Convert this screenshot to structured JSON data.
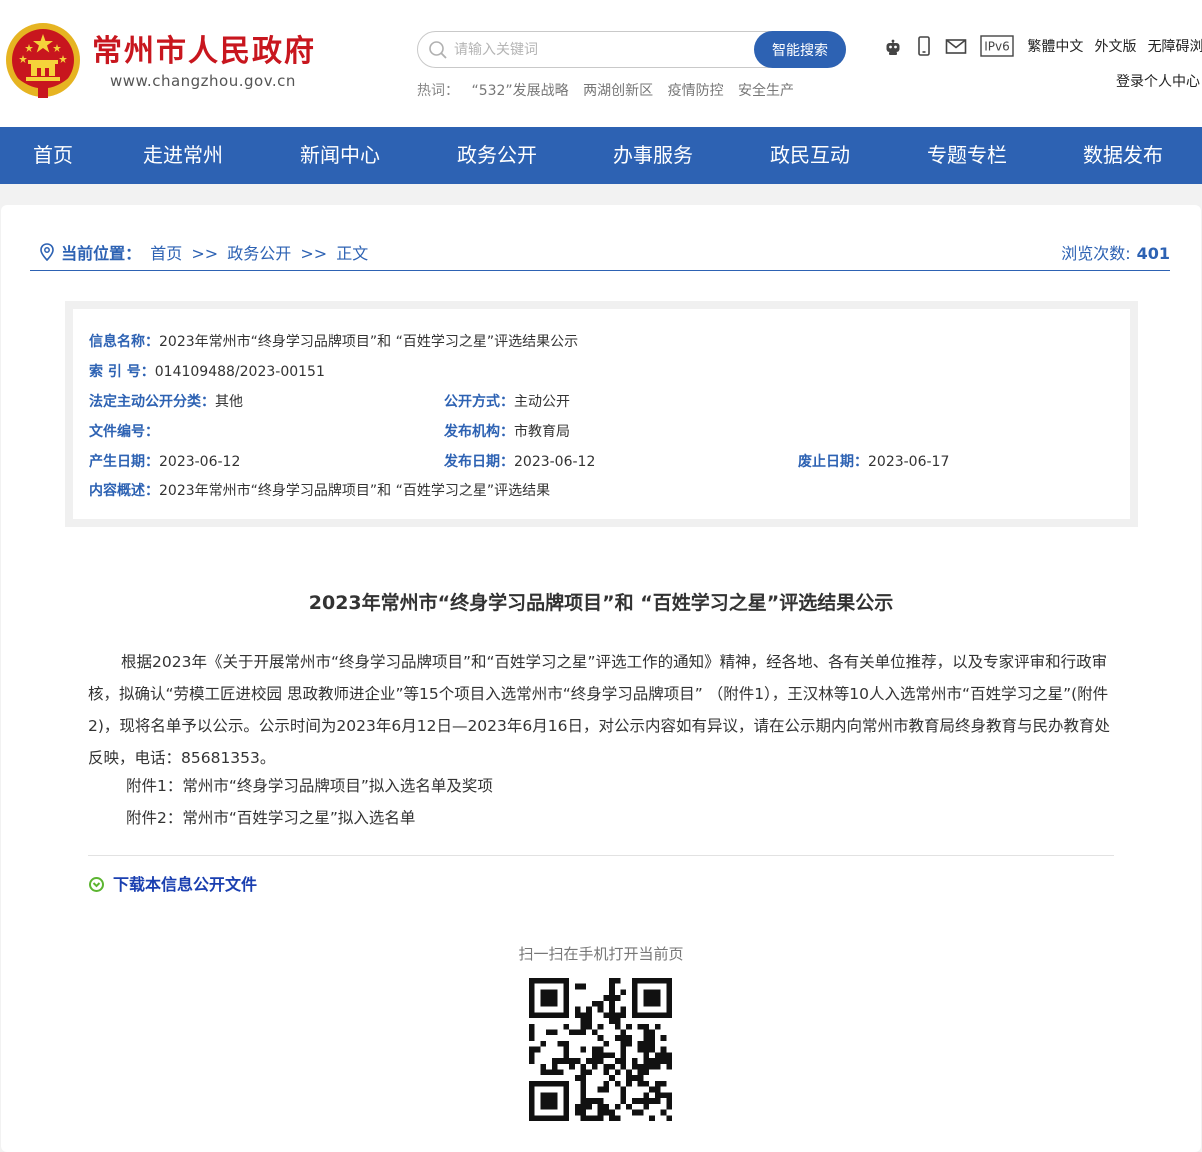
{
  "header": {
    "site_title": "常州市人民政府",
    "site_url": "www.changzhou.gov.cn",
    "search": {
      "placeholder": "请输入关键词",
      "button_label": "智能搜索"
    },
    "hot_label": "热词：",
    "hot_words": [
      "“532”发展战略",
      "两湖创新区",
      "疫情防控",
      "安全生产"
    ],
    "tool_icons": [
      "robot-icon",
      "mobile-icon",
      "mail-icon",
      "ipv6-icon"
    ],
    "ipv6_text": "IPv6",
    "links": [
      "繁體中文",
      "外文版",
      "无障碍浏览"
    ],
    "login_label": "登录个人中心"
  },
  "nav": {
    "items": [
      "首页",
      "走进常州",
      "新闻中心",
      "政务公开",
      "办事服务",
      "政民互动",
      "专题专栏",
      "数据发布"
    ]
  },
  "breadcrumb": {
    "label": "当前位置：",
    "items": [
      "首页",
      "政务公开",
      "正文"
    ],
    "separator": ">>",
    "views_label": "浏览次数:",
    "views_count": "401"
  },
  "info": {
    "name_label": "信息名称：",
    "name_value": "2023年常州市“终身学习品牌项目”和 “百姓学习之星”评选结果公示",
    "index_label": "索 引 号：",
    "index_value": "014109488/2023-00151",
    "category_label": "法定主动公开分类：",
    "category_value": "其他",
    "method_label": "公开方式：",
    "method_value": "主动公开",
    "docno_label": "文件编号：",
    "docno_value": "",
    "org_label": "发布机构：",
    "org_value": "市教育局",
    "created_label": "产生日期：",
    "created_value": "2023-06-12",
    "published_label": "发布日期：",
    "published_value": "2023-06-12",
    "expired_label": "废止日期：",
    "expired_value": "2023-06-17",
    "summary_label": "内容概述：",
    "summary_value": "2023年常州市“终身学习品牌项目”和 “百姓学习之星”评选结果"
  },
  "article": {
    "title": "2023年常州市“终身学习品牌项目”和 “百姓学习之星”评选结果公示",
    "body": "根据2023年《关于开展常州市“终身学习品牌项目”和“百姓学习之星”评选工作的通知》精神，经各地、各有关单位推荐，以及专家评审和行政审核，拟确认“劳模工匠进校园 思政教师进企业”等15个项目入选常州市“终身学习品牌项目” （附件1），王汉林等10人入选常州市“百姓学习之星”(附件2)，现将名单予以公示。公示时间为2023年6月12日—2023年6月16日，对公示内容如有异议，请在公示期内向常州市教育局终身教育与民办教育处反映，电话：85681353。",
    "attachment1": "附件1：常州市“终身学习品牌项目”拟入选名单及奖项",
    "attachment2": "附件2：常州市“百姓学习之星”拟入选名单",
    "download_label": "下载本信息公开文件",
    "qr_label": "扫一扫在手机打开当前页"
  },
  "colors": {
    "brand_blue": "#2d62b3",
    "brand_red": "#c8161e",
    "emblem_gold": "#f1c40f"
  }
}
